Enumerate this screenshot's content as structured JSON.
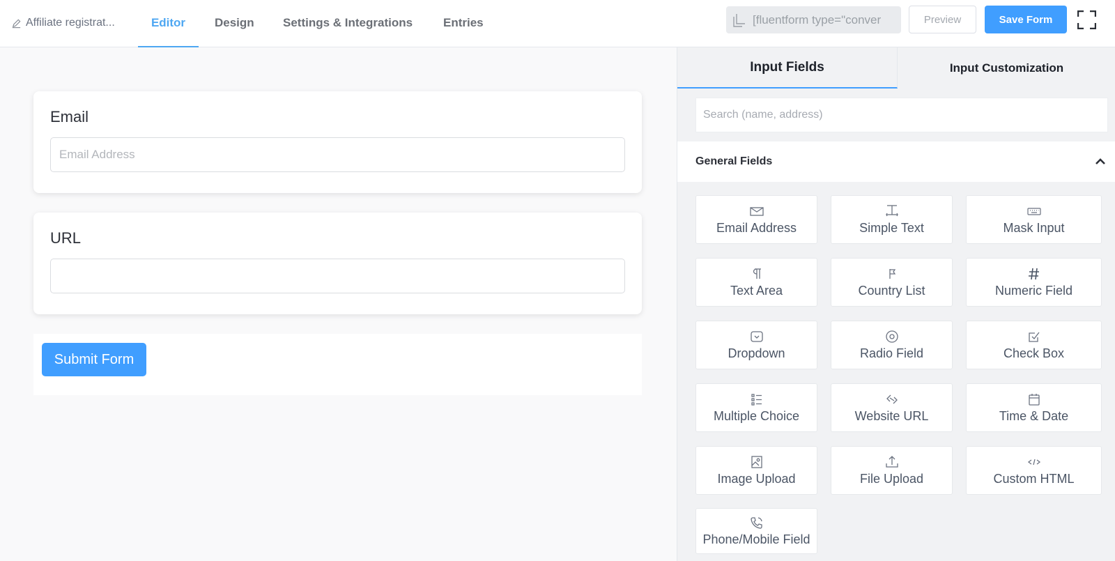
{
  "header": {
    "form_title": "Affiliate registrat...",
    "tabs": [
      {
        "label": "Editor",
        "active": true
      },
      {
        "label": "Design"
      },
      {
        "label": "Settings & Integrations"
      },
      {
        "label": "Entries"
      }
    ],
    "shortcode": "[fluentform type=\"conver",
    "preview_label": "Preview",
    "save_label": "Save Form"
  },
  "canvas": {
    "fields": [
      {
        "label": "Email",
        "placeholder": "Email Address"
      },
      {
        "label": "URL",
        "placeholder": ""
      }
    ],
    "submit_label": "Submit Form"
  },
  "panel": {
    "tabs": [
      "Input Fields",
      "Input Customization"
    ],
    "search_placeholder": "Search (name, address)",
    "section_title": "General Fields",
    "fields": [
      {
        "label": "Email Address",
        "icon": "envelope-icon"
      },
      {
        "label": "Simple Text",
        "icon": "text-cursor-icon"
      },
      {
        "label": "Mask Input",
        "icon": "keyboard-icon"
      },
      {
        "label": "Text Area",
        "icon": "paragraph-icon"
      },
      {
        "label": "Country List",
        "icon": "flag-icon"
      },
      {
        "label": "Numeric Field",
        "icon": "hash-icon"
      },
      {
        "label": "Dropdown",
        "icon": "dropdown-icon"
      },
      {
        "label": "Radio Field",
        "icon": "radio-icon"
      },
      {
        "label": "Check Box",
        "icon": "checkbox-icon"
      },
      {
        "label": "Multiple Choice",
        "icon": "list-icon"
      },
      {
        "label": "Website URL",
        "icon": "link-icon"
      },
      {
        "label": "Time & Date",
        "icon": "calendar-icon"
      },
      {
        "label": "Image Upload",
        "icon": "image-icon"
      },
      {
        "label": "File Upload",
        "icon": "upload-icon"
      },
      {
        "label": "Custom HTML",
        "icon": "code-icon"
      },
      {
        "label": "Phone/Mobile Field",
        "icon": "phone-icon"
      }
    ]
  },
  "colors": {
    "accent": "#409eff",
    "active_tab": "#4ea7f2"
  }
}
